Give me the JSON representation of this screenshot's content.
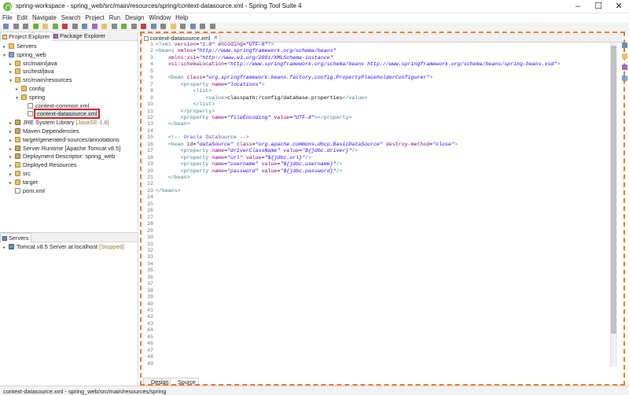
{
  "window": {
    "title": "spring-workspace - spring_web/src/main/resources/spring/context-datasource.xml - Spring Tool Suite 4"
  },
  "menu": [
    "File",
    "Edit",
    "Navigate",
    "Search",
    "Project",
    "Run",
    "Design",
    "Window",
    "Help"
  ],
  "left_panel": {
    "tabs": [
      "Project Explorer",
      "Package Explorer"
    ],
    "tree": [
      {
        "label": "Servers",
        "depth": 0,
        "arrow": "▸",
        "icon": "folder"
      },
      {
        "label": "spring_web",
        "depth": 0,
        "arrow": "▾",
        "icon": "project"
      },
      {
        "label": "src/main/java",
        "depth": 1,
        "arrow": "▸",
        "icon": "folder"
      },
      {
        "label": "src/test/java",
        "depth": 1,
        "arrow": "▸",
        "icon": "folder"
      },
      {
        "label": "src/main/resources",
        "depth": 1,
        "arrow": "▾",
        "icon": "folder"
      },
      {
        "label": "config",
        "depth": 2,
        "arrow": "▸",
        "icon": "folder"
      },
      {
        "label": "spring",
        "depth": 2,
        "arrow": "▾",
        "icon": "folder"
      },
      {
        "label": "context-common.xml",
        "depth": 3,
        "arrow": "",
        "icon": "xml"
      },
      {
        "label": "context-datasource.xml",
        "depth": 3,
        "arrow": "",
        "icon": "xml",
        "selected": true
      },
      {
        "label": "JRE System Library",
        "suffix": "[JavaSE-1.8]",
        "depth": 1,
        "arrow": "▸",
        "icon": "lib"
      },
      {
        "label": "Maven Dependencies",
        "depth": 1,
        "arrow": "▸",
        "icon": "lib"
      },
      {
        "label": "target/generated-sources/annotations",
        "depth": 1,
        "arrow": "▸",
        "icon": "folder"
      },
      {
        "label": "Server Runtime [Apache Tomcat v8.5]",
        "depth": 1,
        "arrow": "▸",
        "icon": "lib"
      },
      {
        "label": "Deployment Descriptor: spring_web",
        "depth": 1,
        "arrow": "▸",
        "icon": "lib"
      },
      {
        "label": "Deployed Resources",
        "depth": 1,
        "arrow": "▸",
        "icon": "folder"
      },
      {
        "label": "src",
        "depth": 1,
        "arrow": "▸",
        "icon": "folder"
      },
      {
        "label": "target",
        "depth": 1,
        "arrow": "▸",
        "icon": "folder"
      },
      {
        "label": "pom.xml",
        "depth": 1,
        "arrow": "",
        "icon": "xml"
      }
    ]
  },
  "servers_panel": {
    "tab": "Servers",
    "items": [
      {
        "label": "Tomcat v8.5 Server at localhost",
        "status": "[Stopped]"
      }
    ]
  },
  "editor": {
    "tab": "context-datasource.xml",
    "bottom_tabs": [
      "Design",
      "Source"
    ],
    "lines": [
      "<?xml version=\"1.0\" encoding=\"UTF-8\"?>",
      "<beans xmlns=\"http://www.springframework.org/schema/beans\"",
      "    xmlns:xsi=\"http://www.w3.org/2001/XMLSchema-instance\"",
      "    xsi:schemaLocation=\"http://www.springframework.org/schema/beans http://www.springframework.org/schema/beans/spring-beans.xsd\">",
      "",
      "    <bean class=\"org.springframework.beans.factory.config.PropertyPlaceholderConfigurer\">",
      "        <property name=\"locations\">",
      "            <list>",
      "                <value>classpath:/config/database.properties</value>",
      "            </list>",
      "        </property>",
      "        <property name=\"fileEncoding\" value=\"UTF-8\"></property>",
      "    </bean>",
      "",
      "    <!-- Oracle DataSource -->",
      "    <bean id=\"dataSource\" class=\"org.apache.commons.dbcp.BasicDataSource\" destroy-method=\"close\">",
      "        <property name=\"driverClassName\" value=\"${jdbc.driver}\"/>",
      "        <property name=\"url\" value=\"${jdbc.url}\"/>",
      "        <property name=\"username\" value=\"${jdbc.username}\"/>",
      "        <property name=\"password\" value=\"${jdbc.password}\"/>",
      "    </bean>",
      "",
      "</beans>"
    ],
    "total_lines": 49
  },
  "statusbar": {
    "text": "context-datasource.xml - spring_web/src/main/resources/spring"
  },
  "colors": {
    "highlight": "#e0201c",
    "dashed": "#ee7a2b",
    "selection": "#dbe9f8"
  }
}
